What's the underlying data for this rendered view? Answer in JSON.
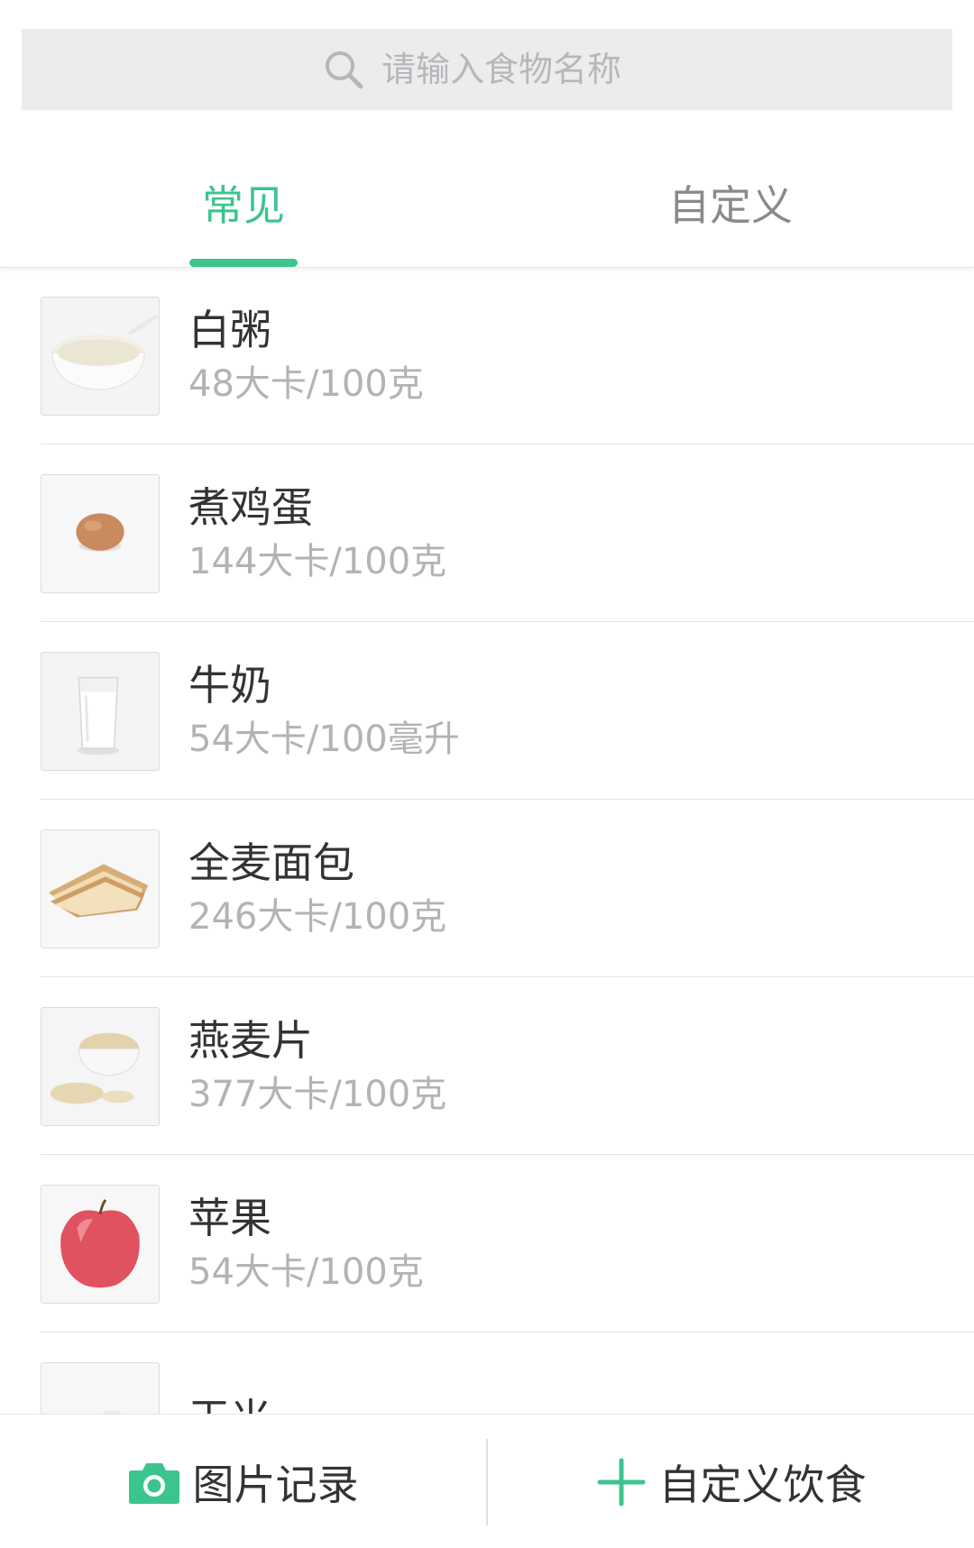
{
  "search": {
    "placeholder": "请输入食物名称",
    "icon": "search-icon"
  },
  "tabs": [
    {
      "label": "常见",
      "active": true
    },
    {
      "label": "自定义",
      "active": false
    }
  ],
  "foods": [
    {
      "name": "白粥",
      "calories": "48大卡/100克",
      "icon": "porridge-image"
    },
    {
      "name": "煮鸡蛋",
      "calories": "144大卡/100克",
      "icon": "boiled-egg-image"
    },
    {
      "name": "牛奶",
      "calories": "54大卡/100毫升",
      "icon": "milk-image"
    },
    {
      "name": "全麦面包",
      "calories": "246大卡/100克",
      "icon": "bread-image"
    },
    {
      "name": "燕麦片",
      "calories": "377大卡/100克",
      "icon": "oatmeal-image"
    },
    {
      "name": "苹果",
      "calories": "54大卡/100克",
      "icon": "apple-image"
    },
    {
      "name": "玉米",
      "calories": "",
      "icon": "corn-image"
    }
  ],
  "bottom_bar": {
    "photo_label": "图片记录",
    "custom_label": "自定义饮食"
  },
  "colors": {
    "accent": "#3cc48f",
    "text_primary": "#333333",
    "text_secondary": "#b3b3b3",
    "search_bg": "#ececed"
  }
}
